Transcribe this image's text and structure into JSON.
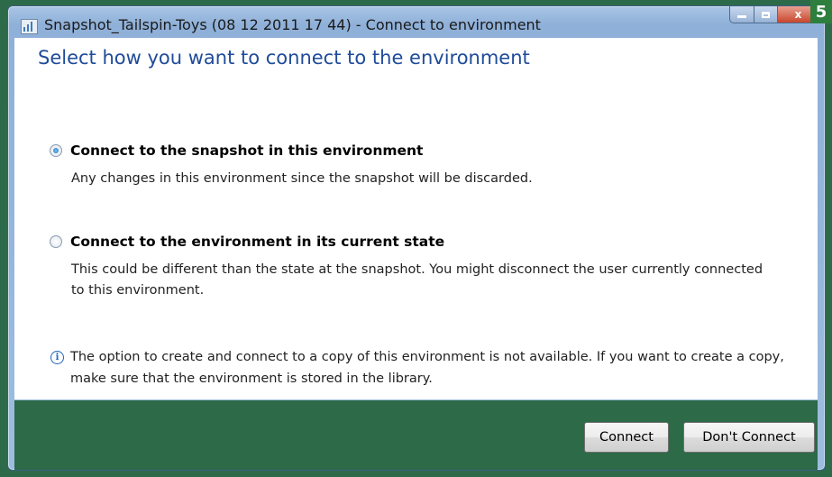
{
  "window": {
    "title": "Snapshot_Tailspin-Toys (08 12 2011 17 44) - Connect to environment",
    "controls": {
      "close_glyph": "x"
    }
  },
  "badge": {
    "number": "5"
  },
  "dialog": {
    "heading": "Select how you want to connect to the environment",
    "options": [
      {
        "label": "Connect to the snapshot in this environment",
        "description": "Any changes in this environment since the snapshot will be discarded.",
        "selected": true
      },
      {
        "label": "Connect to the environment in its current state",
        "description": "This could be different than the state at the snapshot. You might disconnect the user currently connected to this environment.",
        "selected": false
      }
    ],
    "info": "The option to create and connect to a copy of this environment is not available. If you want to create a copy, make sure that the environment is stored in the library."
  },
  "buttons": {
    "connect": "Connect",
    "dont_connect": "Don't Connect"
  },
  "colors": {
    "heading": "#1f4b99",
    "footer": "#2d6a47",
    "badge": "#2e7f3e"
  },
  "icons": {
    "app": "app-icon",
    "info": "info-icon"
  }
}
